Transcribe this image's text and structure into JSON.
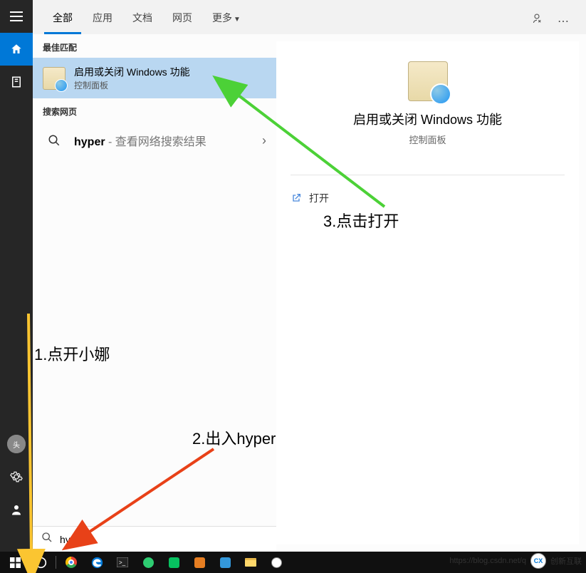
{
  "rail": {
    "menu": "menu",
    "home": "home",
    "notebook": "notebook",
    "settings": "settings",
    "user": "user"
  },
  "tabs": {
    "items": [
      {
        "label": "全部",
        "active": true
      },
      {
        "label": "应用",
        "active": false
      },
      {
        "label": "文档",
        "active": false
      },
      {
        "label": "网页",
        "active": false
      }
    ],
    "more": "更多"
  },
  "results": {
    "best_match_header": "最佳匹配",
    "feature": {
      "title": "启用或关闭 Windows 功能",
      "sub": "控制面板"
    },
    "web_header": "搜索网页",
    "web": {
      "query": "hyper",
      "hint": " - 查看网络搜索结果"
    }
  },
  "detail": {
    "title": "启用或关闭 Windows 功能",
    "sub": "控制面板",
    "open": "打开"
  },
  "search": {
    "value": "hyper"
  },
  "annotations": {
    "a1": "1.点开小娜",
    "a2": "2.出入hyper",
    "a3": "3.点击打开"
  },
  "watermark": {
    "url": "https://blog.csdn.net/q",
    "brand": "创新互联"
  }
}
